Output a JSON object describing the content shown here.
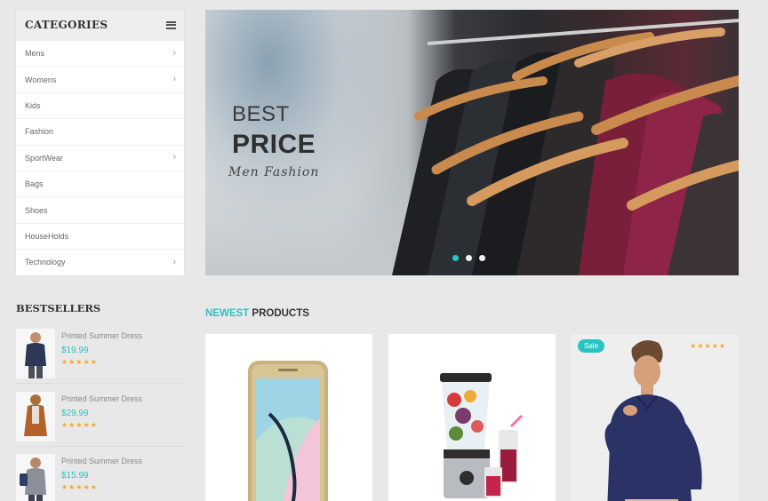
{
  "categories": {
    "title": "CATEGORIES",
    "items": [
      {
        "label": "Mens",
        "has_sub": true
      },
      {
        "label": "Womens",
        "has_sub": true
      },
      {
        "label": "Kids",
        "has_sub": false
      },
      {
        "label": "Fashion",
        "has_sub": false
      },
      {
        "label": "SportWear",
        "has_sub": true
      },
      {
        "label": "Bags",
        "has_sub": false
      },
      {
        "label": "Shoes",
        "has_sub": false
      },
      {
        "label": "HouseHolds",
        "has_sub": false
      },
      {
        "label": "Technology",
        "has_sub": true
      }
    ]
  },
  "hero": {
    "line1": "BEST",
    "line2": "PRICE",
    "script": "Men Fashion",
    "slides": 3,
    "active_slide": 1
  },
  "bestsellers": {
    "title": "BESTSELLERS",
    "items": [
      {
        "name": "Printed Summer Dress",
        "price": "$19.99",
        "stars": "★★★★★"
      },
      {
        "name": "Printed Summer Dress",
        "price": "$29.99",
        "stars": "★★★★★"
      },
      {
        "name": "Printed Summer Dress",
        "price": "$15.99",
        "stars": "★★★★★"
      }
    ]
  },
  "newest": {
    "title_highlight": "NEWEST",
    "title_rest": " PRODUCTS",
    "products": [
      {
        "image": "smartphone"
      },
      {
        "image": "blender"
      },
      {
        "image": "model-shirt",
        "badge": "Sale",
        "stars": "★★★★★"
      }
    ]
  },
  "colors": {
    "accent": "#29c4c2",
    "star": "#f5a623"
  }
}
